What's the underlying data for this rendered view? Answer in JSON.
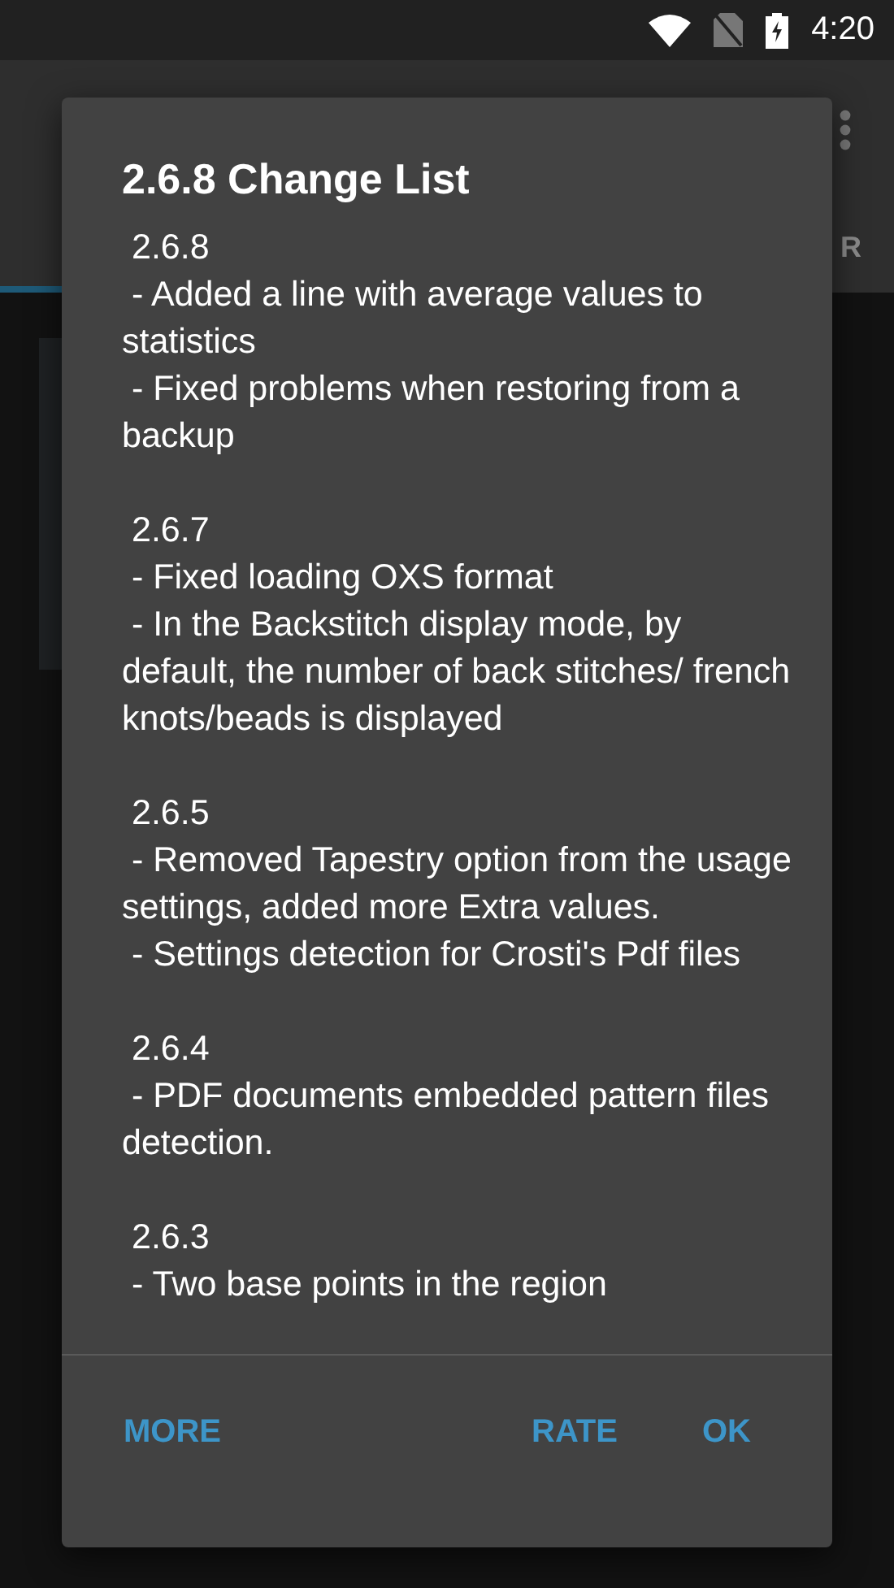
{
  "status_bar": {
    "time": "4:20"
  },
  "app_bar": {
    "tab_label": "R"
  },
  "dialog": {
    "title": "2.6.8 Change List",
    "sections": [
      {
        "version": "2.6.8",
        "items": [
          "- Added a line with average values to statistics",
          "- Fixed problems when restoring from a backup"
        ]
      },
      {
        "version": "2.6.7",
        "items": [
          "- Fixed loading OXS format",
          "- In the Backstitch display mode, by default, the number of back stitches/ french knots/beads is displayed"
        ]
      },
      {
        "version": "2.6.5",
        "items": [
          "- Removed Tapestry option from the usage settings, added more Extra values.",
          "- Settings detection for Crosti's Pdf files"
        ]
      },
      {
        "version": "2.6.4",
        "items": [
          "- PDF documents embedded pattern files detection."
        ]
      },
      {
        "version": "2.6.3",
        "items": [
          "- Two base points in the region"
        ]
      }
    ],
    "buttons": [
      {
        "label": "MORE"
      },
      {
        "label": "RATE"
      },
      {
        "label": "OK"
      }
    ]
  }
}
